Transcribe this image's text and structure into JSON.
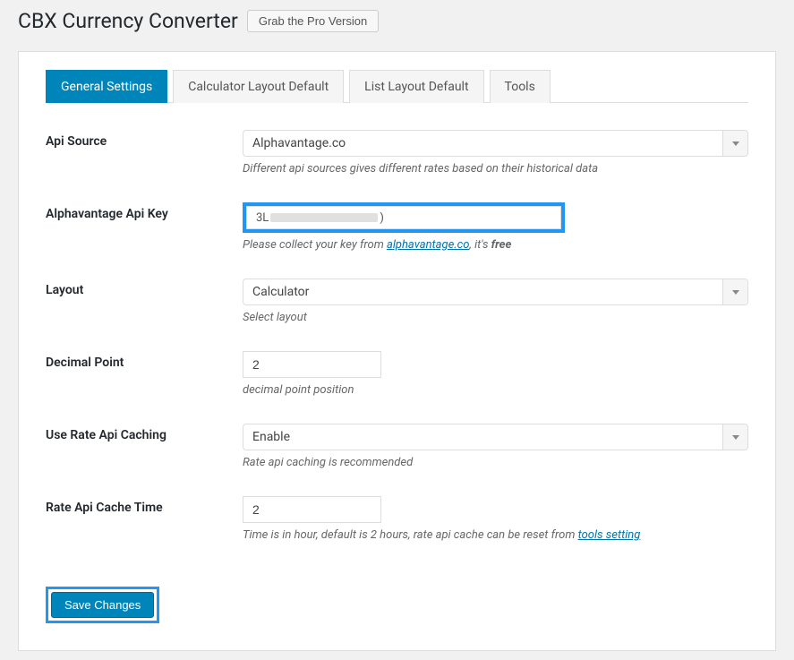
{
  "header": {
    "title": "CBX Currency Converter",
    "pro_button": "Grab the Pro Version"
  },
  "tabs": [
    {
      "label": "General Settings",
      "active": true
    },
    {
      "label": "Calculator Layout Default",
      "active": false
    },
    {
      "label": "List Layout Default",
      "active": false
    },
    {
      "label": "Tools",
      "active": false
    }
  ],
  "fields": {
    "api_source": {
      "label": "Api Source",
      "value": "Alphavantage.co",
      "help": "Different api sources gives different rates based on their historical data"
    },
    "api_key": {
      "label": "Alphavantage Api Key",
      "prefix": "3L",
      "suffix": ")",
      "help_before": "Please collect your key from ",
      "help_link": "alphavantage.co",
      "help_after": ", it's ",
      "help_bold": "free"
    },
    "layout": {
      "label": "Layout",
      "value": "Calculator",
      "help": "Select layout"
    },
    "decimal_point": {
      "label": "Decimal Point",
      "value": "2",
      "help": "decimal point position"
    },
    "caching": {
      "label": "Use Rate Api Caching",
      "value": "Enable",
      "help": "Rate api caching is recommended"
    },
    "cache_time": {
      "label": "Rate Api Cache Time",
      "value": "2",
      "help_before": "Time is in hour, default is 2 hours, rate api cache can be reset from ",
      "help_link": "tools setting"
    }
  },
  "save_button": "Save Changes"
}
